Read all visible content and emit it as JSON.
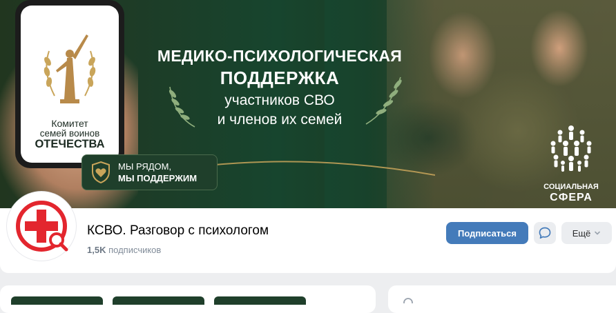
{
  "cover": {
    "headline_line1": "МЕДИКО-ПСИХОЛОГИЧЕСКАЯ",
    "headline_line2": "ПОДДЕРЖКА",
    "headline_line3": "участников СВО",
    "headline_line4": "и членов их семей",
    "phone_text_line1": "Комитет",
    "phone_text_line2": "семей воинов",
    "phone_text_line3": "ОТЕЧЕСТВА",
    "badge_line1": "МЫ РЯДОМ,",
    "badge_line2": "МЫ ПОДДЕРЖИМ",
    "partner_line1": "СОЦИАЛЬНАЯ",
    "partner_line2": "СФЕРА"
  },
  "profile": {
    "name": "КСВО. Разговор с психологом",
    "subscribers_count": "1,5K",
    "subscribers_label": "подписчиков",
    "subscribe_label": "Подписаться",
    "more_label": "Ещё"
  },
  "colors": {
    "accent": "#447bba",
    "cover_green": "#17452e",
    "badge_green": "#1f3f2b",
    "logo_red": "#e3262e",
    "gold": "#c9a55a"
  },
  "icons": {
    "avatar": "red-cross-search-logo",
    "message": "message-icon",
    "more": "chevron-down-icon",
    "badge": "shield-heart-icon"
  }
}
